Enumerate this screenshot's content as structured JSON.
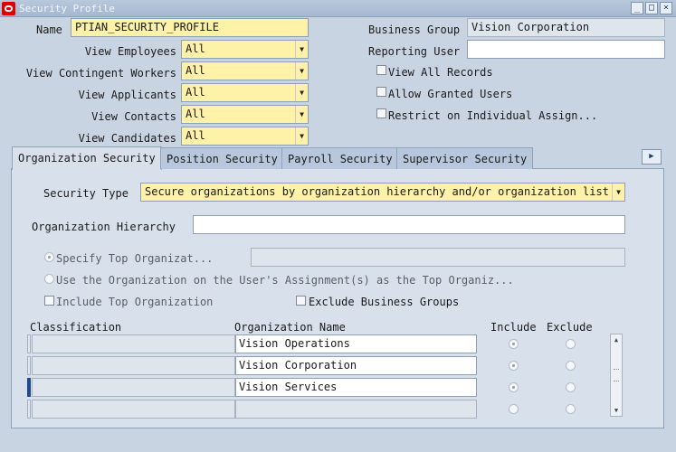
{
  "window": {
    "title": "Security Profile",
    "buttons": {
      "minimize": "_",
      "maximize": "□",
      "close": "×"
    }
  },
  "header": {
    "name_label": "Name",
    "name_value": "PTIAN_SECURITY_PROFILE",
    "business_group_label": "Business Group",
    "business_group_value": "Vision Corporation",
    "reporting_user_label": "Reporting User",
    "reporting_user_value": "",
    "view_fields": [
      {
        "label": "View Employees",
        "value": "All"
      },
      {
        "label": "View Contingent Workers",
        "value": "All"
      },
      {
        "label": "View Applicants",
        "value": "All"
      },
      {
        "label": "View Contacts",
        "value": "All"
      },
      {
        "label": "View Candidates",
        "value": "All"
      }
    ],
    "checkboxes": [
      {
        "label": "View All Records",
        "checked": false
      },
      {
        "label": "Allow Granted Users",
        "checked": false
      },
      {
        "label": "Restrict on Individual Assign...",
        "checked": false
      }
    ]
  },
  "tabs": [
    {
      "label": "Organization Security",
      "active": true
    },
    {
      "label": "Position Security",
      "active": false
    },
    {
      "label": "Payroll Security",
      "active": false
    },
    {
      "label": "Supervisor Security",
      "active": false
    }
  ],
  "org_security": {
    "security_type_label": "Security Type",
    "security_type_value": "Secure organizations by organization hierarchy and/or organization list",
    "org_hierarchy_label": "Organization Hierarchy",
    "org_hierarchy_value": "",
    "specify_top_label": "Specify Top Organizat...",
    "specify_top_value": "",
    "use_user_org_label": "Use the Organization on the User's Assignment(s) as the Top Organiz...",
    "include_top_label": "Include Top Organization",
    "exclude_bg_label": "Exclude Business Groups",
    "table": {
      "headers": {
        "classification": "Classification",
        "organization_name": "Organization Name",
        "include": "Include",
        "exclude": "Exclude"
      },
      "rows": [
        {
          "classification": "",
          "organization_name": "Vision Operations",
          "include": true,
          "exclude": false
        },
        {
          "classification": "",
          "organization_name": "Vision Corporation",
          "include": true,
          "exclude": false
        },
        {
          "classification": "",
          "organization_name": "Vision Services",
          "include": true,
          "exclude": false
        },
        {
          "classification": "",
          "organization_name": "",
          "include": false,
          "exclude": false
        }
      ]
    }
  },
  "colors": {
    "required_field": "#fdf2a7",
    "panel_background": "#d7e0eb",
    "window_background": "#c9d4e2"
  }
}
